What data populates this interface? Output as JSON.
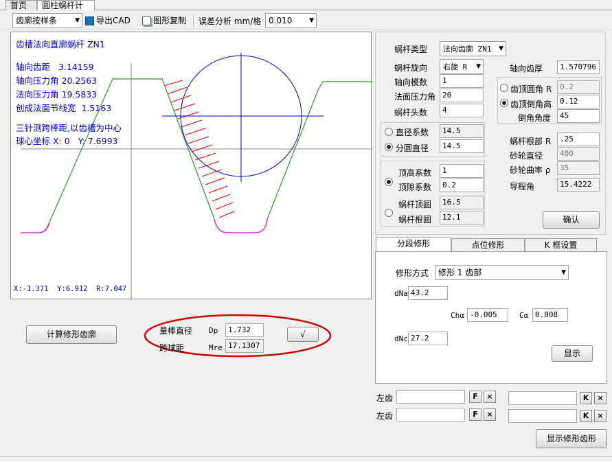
{
  "tabs": [
    "首页",
    "圆柱蜗杆计算"
  ],
  "toolbar": {
    "profile_select": "齿廓按样条",
    "export_cad": "导出CAD",
    "copy_figure": "图形复制",
    "error_label": "误差分析 mm/格",
    "error_value": "0.010"
  },
  "canvas": {
    "title": "齿槽法向直廓蜗杆 ZN1",
    "info": [
      {
        "label": "轴向齿距",
        "value": "3.14159"
      },
      {
        "label": "轴向压力角",
        "value": "20.2563"
      },
      {
        "label": "法向压力角",
        "value": "19.5833"
      },
      {
        "label": "创成法面节线宽",
        "value": "1.5163"
      }
    ],
    "note1": "三针测跨棒距,以齿槽为中心",
    "note2": "球心坐标 X: 0   Y: 7.6993",
    "cursor": "X:-1.371  Y:6.912  R:7.047"
  },
  "bottom_left": {
    "calc_button": "计算修形齿廓",
    "pin_dia_label": "量棒直径",
    "pin_dia_sym": "Dp",
    "pin_dia_value": "1.732",
    "span_label": "跨球距",
    "span_sym": "Mre",
    "span_value": "17.1307",
    "check_button": "√"
  },
  "params": {
    "worm_type_label": "蜗杆类型",
    "worm_type_value": "法向齿廓 ZN1",
    "hand_label": "蜗杆旋向",
    "hand_value": "右旋 R",
    "axial_thick_label": "轴向齿厚",
    "axial_thick_value": "1.570796",
    "module_label": "轴向模数",
    "module_value": "1",
    "pressure_label": "法面压力角",
    "pressure_value": "20",
    "starts_label": "蜗杆头数",
    "starts_value": "4",
    "tip_round_label": "齿顶圆角 R",
    "tip_round_value": "0.2",
    "tip_chamfer_label": "齿顶倒角高",
    "tip_chamfer_value": "0.12",
    "chamfer_angle_label": "倒角角度",
    "chamfer_angle_value": "45",
    "dia_coef_label": "直径系数",
    "dia_coef_value": "14.5",
    "ref_dia_label": "分圆直径",
    "ref_dia_value": "14.5",
    "root_r_label": "蜗杆根部 R",
    "root_r_value": ".25",
    "wheel_dia_label": "砂轮直径",
    "wheel_dia_value": "400",
    "wheel_curv_label": "砂轮曲率 ρ",
    "wheel_curv_value": "35",
    "lead_label": "导程角",
    "lead_value": "15.4222",
    "addendum_label": "顶高系数",
    "addendum_value": "1",
    "clearance_label": "顶隙系数",
    "clearance_value": "0.2",
    "tip_dia_label": "蜗杆顶圆",
    "tip_dia_value": "16.5",
    "root_dia_label": "蜗杆根圆",
    "root_dia_value": "12.1",
    "confirm_button": "确认"
  },
  "mod_tabs": [
    "分段修形",
    "点位修形",
    "K 框设置"
  ],
  "mod": {
    "mode_label": "修形方式",
    "mode_value": "修形 1  齿部",
    "dna_label": "dNa",
    "dna_value": "43.2",
    "cha_label": "Chα",
    "cha_value": "-0.005",
    "ca_label": "Cα",
    "ca_value": "0.008",
    "dnc_label": "dNc",
    "dnc_value": "27.2",
    "show_button": "显示"
  },
  "flank": {
    "left1": "左齿",
    "left2": "左齿",
    "f_btn": "F",
    "k_btn": "K",
    "x_btn": "×"
  },
  "show_profile_button": "显示修形齿形",
  "colors": {
    "text_blue": "#0000cc",
    "profile_green": "#2a9a2a",
    "profile_magenta": "#e000e0",
    "hatch_red": "#e00000",
    "annotation_red": "#cc0000"
  }
}
